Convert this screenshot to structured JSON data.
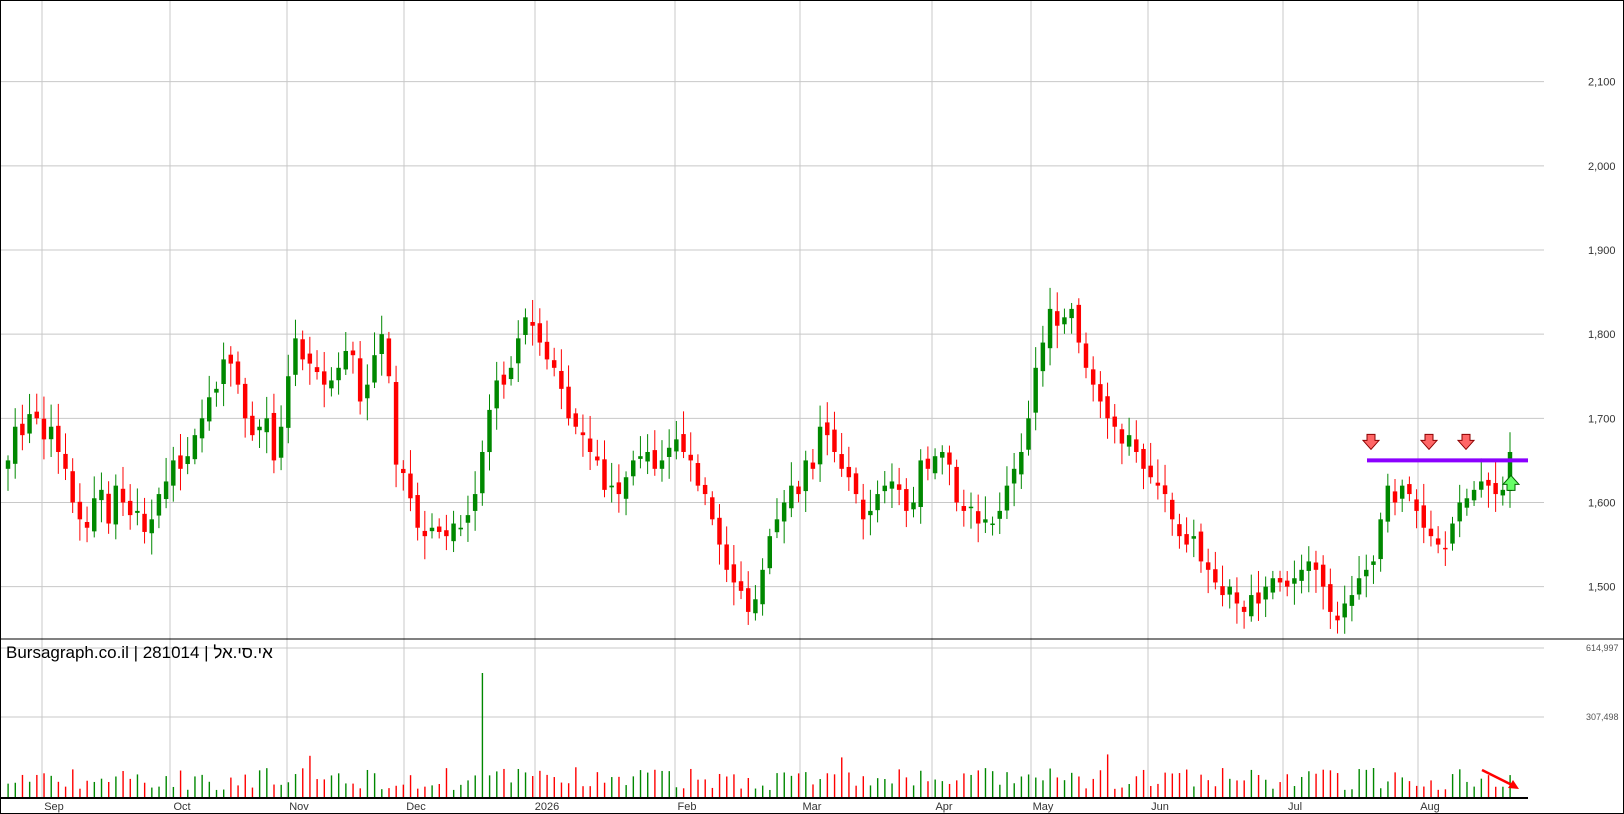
{
  "caption": {
    "site": "Bursagraph.co.il",
    "sep1": " | ",
    "code": "281014",
    "sep2": " | ",
    "name": "אי.סי.אל"
  },
  "colors": {
    "up": "#008800",
    "down": "#ff0000",
    "grid": "#c8c8c8",
    "resistance": "#8b00ff",
    "down_arrow": "#ff6666",
    "up_arrow": "#66ff66",
    "trend_arrow": "#ff0000"
  },
  "chart_data": [
    {
      "type": "candlestick",
      "title": "",
      "y_ticks": [
        "2,100",
        "2,000",
        "1,900",
        "1,800",
        "1,700",
        "1,600",
        "1,500"
      ],
      "y_tick_values": [
        2100,
        2000,
        1900,
        1800,
        1700,
        1600,
        1500
      ],
      "ylim": [
        1439,
        2197
      ],
      "x_ticks": [
        "Sep",
        "Oct",
        "Nov",
        "Dec",
        "2026",
        "Feb",
        "Mar",
        "Apr",
        "May",
        "Jun",
        "Jul",
        "Aug"
      ],
      "grid": true,
      "closes": [
        1650,
        1690,
        1680,
        1705,
        1700,
        1675,
        1690,
        1660,
        1640,
        1600,
        1580,
        1570,
        1605,
        1615,
        1575,
        1620,
        1600,
        1585,
        1590,
        1565,
        1580,
        1610,
        1625,
        1650,
        1640,
        1655,
        1680,
        1700,
        1725,
        1735,
        1770,
        1765,
        1740,
        1700,
        1680,
        1690,
        1700,
        1650,
        1690,
        1750,
        1795,
        1770,
        1765,
        1755,
        1740,
        1745,
        1760,
        1780,
        1775,
        1720,
        1740,
        1775,
        1800,
        1750,
        1645,
        1635,
        1605,
        1570,
        1560,
        1570,
        1565,
        1560,
        1575,
        1570,
        1585,
        1610,
        1660,
        1710,
        1745,
        1740,
        1760,
        1795,
        1820,
        1810,
        1790,
        1770,
        1760,
        1735,
        1700,
        1690,
        1680,
        1660,
        1650,
        1615,
        1620,
        1610,
        1630,
        1650,
        1655,
        1660,
        1640,
        1650,
        1665,
        1675,
        1660,
        1650,
        1620,
        1610,
        1580,
        1550,
        1520,
        1505,
        1495,
        1470,
        1485,
        1520,
        1560,
        1580,
        1600,
        1620,
        1610,
        1650,
        1640,
        1690,
        1680,
        1660,
        1640,
        1630,
        1610,
        1580,
        1590,
        1610,
        1620,
        1625,
        1615,
        1590,
        1600,
        1650,
        1640,
        1655,
        1660,
        1645,
        1600,
        1590,
        1595,
        1575,
        1580,
        1575,
        1590,
        1620,
        1640,
        1660,
        1700,
        1760,
        1790,
        1830,
        1810,
        1820,
        1830,
        1790,
        1760,
        1740,
        1720,
        1700,
        1690,
        1670,
        1680,
        1660,
        1640,
        1630,
        1620,
        1610,
        1580,
        1560,
        1550,
        1560,
        1530,
        1520,
        1505,
        1490,
        1500,
        1480,
        1470,
        1490,
        1480,
        1500,
        1510,
        1505,
        1500,
        1510,
        1520,
        1530,
        1520,
        1500,
        1470,
        1460,
        1480,
        1490,
        1510,
        1520,
        1530,
        1580,
        1620,
        1600,
        1620,
        1610,
        1590,
        1570,
        1560,
        1550,
        1545,
        1575,
        1600,
        1605,
        1615,
        1625,
        1620,
        1610,
        1615,
        1660
      ],
      "x_ticks_positions_note": "",
      "volume": {
        "y_ticks": [
          "614,997",
          "307,498"
        ],
        "y_tick_values": [
          614997,
          307498
        ],
        "ylim": [
          0,
          614997
        ]
      },
      "annotations": {
        "resistance_level": 1650,
        "sell_signal_count": 3,
        "buy_signal_count": 1,
        "volume_trend": "down"
      }
    }
  ]
}
